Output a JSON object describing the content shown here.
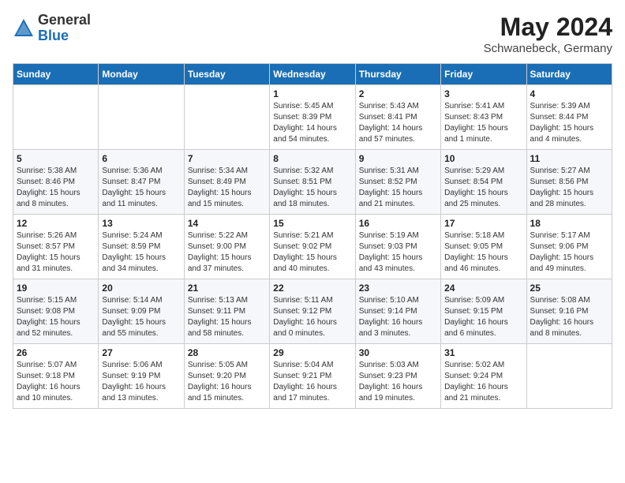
{
  "logo": {
    "general": "General",
    "blue": "Blue"
  },
  "title": "May 2024",
  "subtitle": "Schwanebeck, Germany",
  "days_of_week": [
    "Sunday",
    "Monday",
    "Tuesday",
    "Wednesday",
    "Thursday",
    "Friday",
    "Saturday"
  ],
  "weeks": [
    [
      {
        "day": "",
        "info": ""
      },
      {
        "day": "",
        "info": ""
      },
      {
        "day": "",
        "info": ""
      },
      {
        "day": "1",
        "info": "Sunrise: 5:45 AM\nSunset: 8:39 PM\nDaylight: 14 hours\nand 54 minutes."
      },
      {
        "day": "2",
        "info": "Sunrise: 5:43 AM\nSunset: 8:41 PM\nDaylight: 14 hours\nand 57 minutes."
      },
      {
        "day": "3",
        "info": "Sunrise: 5:41 AM\nSunset: 8:43 PM\nDaylight: 15 hours\nand 1 minute."
      },
      {
        "day": "4",
        "info": "Sunrise: 5:39 AM\nSunset: 8:44 PM\nDaylight: 15 hours\nand 4 minutes."
      }
    ],
    [
      {
        "day": "5",
        "info": "Sunrise: 5:38 AM\nSunset: 8:46 PM\nDaylight: 15 hours\nand 8 minutes."
      },
      {
        "day": "6",
        "info": "Sunrise: 5:36 AM\nSunset: 8:47 PM\nDaylight: 15 hours\nand 11 minutes."
      },
      {
        "day": "7",
        "info": "Sunrise: 5:34 AM\nSunset: 8:49 PM\nDaylight: 15 hours\nand 15 minutes."
      },
      {
        "day": "8",
        "info": "Sunrise: 5:32 AM\nSunset: 8:51 PM\nDaylight: 15 hours\nand 18 minutes."
      },
      {
        "day": "9",
        "info": "Sunrise: 5:31 AM\nSunset: 8:52 PM\nDaylight: 15 hours\nand 21 minutes."
      },
      {
        "day": "10",
        "info": "Sunrise: 5:29 AM\nSunset: 8:54 PM\nDaylight: 15 hours\nand 25 minutes."
      },
      {
        "day": "11",
        "info": "Sunrise: 5:27 AM\nSunset: 8:56 PM\nDaylight: 15 hours\nand 28 minutes."
      }
    ],
    [
      {
        "day": "12",
        "info": "Sunrise: 5:26 AM\nSunset: 8:57 PM\nDaylight: 15 hours\nand 31 minutes."
      },
      {
        "day": "13",
        "info": "Sunrise: 5:24 AM\nSunset: 8:59 PM\nDaylight: 15 hours\nand 34 minutes."
      },
      {
        "day": "14",
        "info": "Sunrise: 5:22 AM\nSunset: 9:00 PM\nDaylight: 15 hours\nand 37 minutes."
      },
      {
        "day": "15",
        "info": "Sunrise: 5:21 AM\nSunset: 9:02 PM\nDaylight: 15 hours\nand 40 minutes."
      },
      {
        "day": "16",
        "info": "Sunrise: 5:19 AM\nSunset: 9:03 PM\nDaylight: 15 hours\nand 43 minutes."
      },
      {
        "day": "17",
        "info": "Sunrise: 5:18 AM\nSunset: 9:05 PM\nDaylight: 15 hours\nand 46 minutes."
      },
      {
        "day": "18",
        "info": "Sunrise: 5:17 AM\nSunset: 9:06 PM\nDaylight: 15 hours\nand 49 minutes."
      }
    ],
    [
      {
        "day": "19",
        "info": "Sunrise: 5:15 AM\nSunset: 9:08 PM\nDaylight: 15 hours\nand 52 minutes."
      },
      {
        "day": "20",
        "info": "Sunrise: 5:14 AM\nSunset: 9:09 PM\nDaylight: 15 hours\nand 55 minutes."
      },
      {
        "day": "21",
        "info": "Sunrise: 5:13 AM\nSunset: 9:11 PM\nDaylight: 15 hours\nand 58 minutes."
      },
      {
        "day": "22",
        "info": "Sunrise: 5:11 AM\nSunset: 9:12 PM\nDaylight: 16 hours\nand 0 minutes."
      },
      {
        "day": "23",
        "info": "Sunrise: 5:10 AM\nSunset: 9:14 PM\nDaylight: 16 hours\nand 3 minutes."
      },
      {
        "day": "24",
        "info": "Sunrise: 5:09 AM\nSunset: 9:15 PM\nDaylight: 16 hours\nand 6 minutes."
      },
      {
        "day": "25",
        "info": "Sunrise: 5:08 AM\nSunset: 9:16 PM\nDaylight: 16 hours\nand 8 minutes."
      }
    ],
    [
      {
        "day": "26",
        "info": "Sunrise: 5:07 AM\nSunset: 9:18 PM\nDaylight: 16 hours\nand 10 minutes."
      },
      {
        "day": "27",
        "info": "Sunrise: 5:06 AM\nSunset: 9:19 PM\nDaylight: 16 hours\nand 13 minutes."
      },
      {
        "day": "28",
        "info": "Sunrise: 5:05 AM\nSunset: 9:20 PM\nDaylight: 16 hours\nand 15 minutes."
      },
      {
        "day": "29",
        "info": "Sunrise: 5:04 AM\nSunset: 9:21 PM\nDaylight: 16 hours\nand 17 minutes."
      },
      {
        "day": "30",
        "info": "Sunrise: 5:03 AM\nSunset: 9:23 PM\nDaylight: 16 hours\nand 19 minutes."
      },
      {
        "day": "31",
        "info": "Sunrise: 5:02 AM\nSunset: 9:24 PM\nDaylight: 16 hours\nand 21 minutes."
      },
      {
        "day": "",
        "info": ""
      }
    ]
  ]
}
